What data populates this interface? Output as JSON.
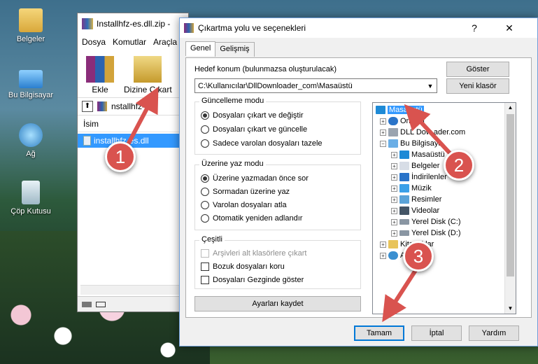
{
  "desktop": {
    "icons": [
      {
        "label": "Belgeler",
        "icon": "folder-icon"
      },
      {
        "label": "Bu Bilgisayar",
        "icon": "computer-icon"
      },
      {
        "label": "Ağ",
        "icon": "network-icon"
      },
      {
        "label": "Çöp Kutusu",
        "icon": "recycle-bin-icon"
      }
    ]
  },
  "winrar": {
    "title": "Installhfz-es.dll.zip -",
    "menu": [
      "Dosya",
      "Komutlar",
      "Araçla"
    ],
    "tools": [
      "Ekle",
      "Dizine Çıkart"
    ],
    "path": "nstallhfz-e",
    "column": "İsim",
    "file": "installhfz-es.dll"
  },
  "dialog": {
    "title": "Çıkartma yolu ve seçenekleri",
    "help": "?",
    "close": "✕",
    "tabs": [
      "Genel",
      "Gelişmiş"
    ],
    "dest_label": "Hedef konum (bulunmazsa oluşturulacak)",
    "dest_value": "C:\\Kullanıcılar\\DllDownloader_com\\Masaüstü",
    "show_button": "Göster",
    "new_folder_button": "Yeni klasör",
    "update_mode": {
      "title": "Güncelleme modu",
      "options": [
        "Dosyaları çıkart ve değiştir",
        "Dosyaları çıkart ve güncelle",
        "Sadece varolan dosyaları tazele"
      ],
      "selected": 0
    },
    "overwrite_mode": {
      "title": "Üzerine yaz modu",
      "options": [
        "Üzerine yazmadan önce sor",
        "Sormadan üzerine yaz",
        "Varolan dosyaları atla",
        "Otomatik yeniden adlandır"
      ],
      "selected": 0
    },
    "misc": {
      "title": "Çeşitli",
      "options": [
        "Arşivleri alt klasörlere çıkart",
        "Bozuk dosyaları koru",
        "Dosyaları Gezginde göster"
      ],
      "disabled": [
        true,
        false,
        false
      ]
    },
    "save_settings": "Ayarları kaydet",
    "tree": [
      {
        "label": "Masaüstü",
        "selected": true
      },
      {
        "label": "OneDri"
      },
      {
        "label": "DLL Dow    ader.com"
      },
      {
        "label": "Bu Bilgisaya"
      },
      {
        "label": "Masaüstü"
      },
      {
        "label": "Belgeler"
      },
      {
        "label": "İndirilenler"
      },
      {
        "label": "Müzik"
      },
      {
        "label": "Resimler"
      },
      {
        "label": "Videolar"
      },
      {
        "label": "Yerel Disk (C:)"
      },
      {
        "label": "Yerel Disk (D:)"
      },
      {
        "label": "Kitaplıklar"
      },
      {
        "label": "Ağ"
      }
    ],
    "ok": "Tamam",
    "cancel": "İptal",
    "help_button": "Yardım"
  },
  "annotations": [
    "1",
    "2",
    "3"
  ],
  "colors": {
    "annotation": "#d9534f",
    "selection": "#3399ff",
    "accent": "#0078d7"
  }
}
